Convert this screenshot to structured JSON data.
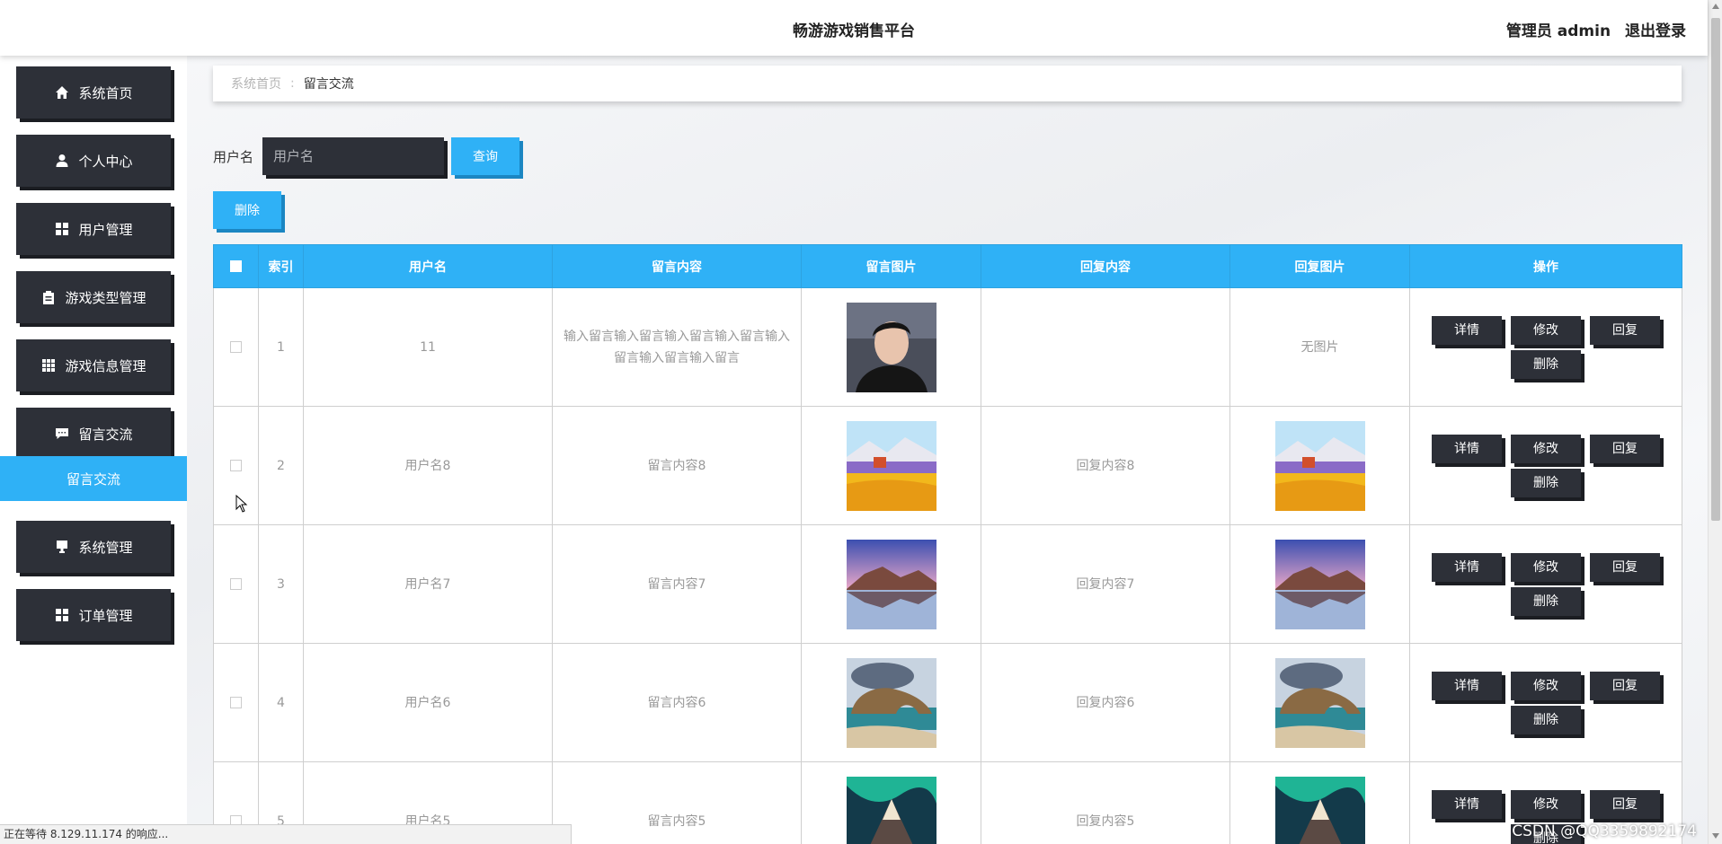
{
  "header": {
    "title": "畅游游戏销售平台",
    "user_label": "管理员 admin",
    "logout_label": "退出登录"
  },
  "sidebar": {
    "items": [
      {
        "label": "系统首页",
        "icon": "home-icon"
      },
      {
        "label": "个人中心",
        "icon": "user-icon"
      },
      {
        "label": "用户管理",
        "icon": "grid-icon"
      },
      {
        "label": "游戏类型管理",
        "icon": "clipboard-icon"
      },
      {
        "label": "游戏信息管理",
        "icon": "table-icon"
      },
      {
        "label": "留言交流",
        "icon": "chat-icon"
      },
      {
        "label": "系统管理",
        "icon": "monitor-icon"
      },
      {
        "label": "订单管理",
        "icon": "grid-icon"
      }
    ],
    "active_sub": "留言交流"
  },
  "breadcrumb": {
    "home": "系统首页",
    "current": "留言交流"
  },
  "search": {
    "label": "用户名",
    "placeholder": "用户名",
    "button": "查询"
  },
  "delete_button": "删除",
  "table": {
    "headers": [
      "",
      "索引",
      "用户名",
      "留言内容",
      "留言图片",
      "回复内容",
      "回复图片",
      "操作"
    ],
    "rows": [
      {
        "index": "1",
        "username": "11",
        "message": "输入留言输入留言输入留言输入留言输入留言输入留言输入留言",
        "message_image": "portrait-photo",
        "reply": "",
        "reply_image": "无图片"
      },
      {
        "index": "2",
        "username": "用户名8",
        "message": "留言内容8",
        "message_image": "flower-field-painting",
        "reply": "回复内容8",
        "reply_image": "flower-field-painting"
      },
      {
        "index": "3",
        "username": "用户名7",
        "message": "留言内容7",
        "message_image": "mountain-lake",
        "reply": "回复内容7",
        "reply_image": "mountain-lake"
      },
      {
        "index": "4",
        "username": "用户名6",
        "message": "留言内容6",
        "message_image": "sea-arch",
        "reply": "回复内容6",
        "reply_image": "sea-arch"
      },
      {
        "index": "5",
        "username": "用户名5",
        "message": "留言内容5",
        "message_image": "aurora-mountain",
        "reply": "回复内容5",
        "reply_image": "aurora-mountain"
      }
    ],
    "ops": {
      "detail": "详情",
      "edit": "修改",
      "reply": "回复",
      "delete": "删除"
    }
  },
  "status_bar": "正在等待 8.129.11.174 的响应...",
  "watermark": "CSDN @QQ3359892174",
  "colors": {
    "accent": "#2fb1f6",
    "dark": "#2d3038"
  }
}
